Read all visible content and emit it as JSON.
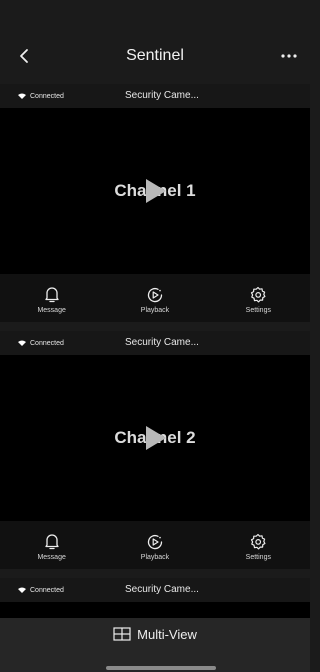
{
  "nav": {
    "title": "Sentinel"
  },
  "cameras": [
    {
      "status": "Connected",
      "name": "Security Came...",
      "channel": "Channel 1",
      "actions": {
        "message": "Message",
        "playback": "Playback",
        "settings": "Settings"
      }
    },
    {
      "status": "Connected",
      "name": "Security Came...",
      "channel": "Channel 2",
      "actions": {
        "message": "Message",
        "playback": "Playback",
        "settings": "Settings"
      }
    },
    {
      "status": "Connected",
      "name": "Security Came..."
    }
  ],
  "bottom": {
    "multiview_label": "Multi-View"
  },
  "colors": {
    "background": "#1b1b1b",
    "video": "#000000",
    "bottom_bar": "#262626"
  },
  "icons": [
    "chevron-left-icon",
    "more-icon",
    "wifi-icon",
    "play-icon",
    "bell-icon",
    "playback-icon",
    "gear-icon",
    "grid-icon"
  ]
}
